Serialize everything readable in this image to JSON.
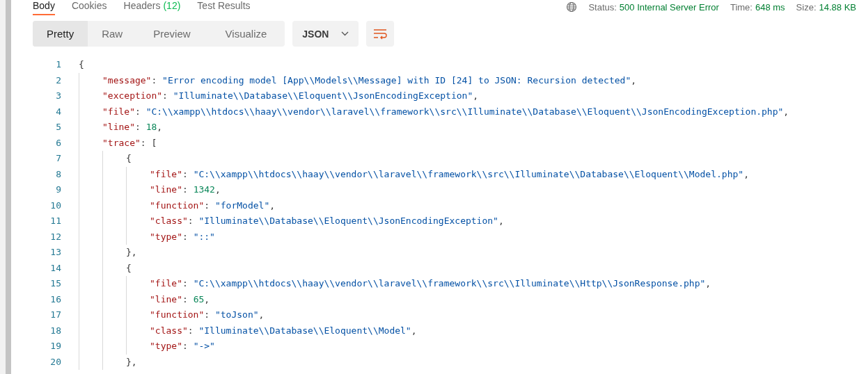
{
  "response_tabs": [
    {
      "label": "Body",
      "selected": true
    },
    {
      "label": "Cookies",
      "selected": false
    },
    {
      "label": "Headers",
      "count": "(12)",
      "selected": false
    },
    {
      "label": "Test Results",
      "selected": false
    }
  ],
  "status_bar": [
    {
      "label": "Status:",
      "value": "500 Internal Server Error"
    },
    {
      "label": "Time:",
      "value": "648 ms"
    },
    {
      "label": "Size:",
      "value": "14.88 KB"
    }
  ],
  "view_modes": [
    {
      "label": "Pretty",
      "selected": true
    },
    {
      "label": "Raw",
      "selected": false
    },
    {
      "label": "Preview",
      "selected": false
    },
    {
      "label": "Visualize",
      "selected": false
    }
  ],
  "format_dropdown": {
    "value": "JSON"
  },
  "wrap_button": {
    "on": false
  },
  "code": [
    {
      "number": "1",
      "tokens": [
        {
          "kind": "punct",
          "text": "{"
        }
      ],
      "children": [
        {
          "number": "2",
          "tokens": [
            {
              "kind": "key",
              "text": "\"message\""
            },
            {
              "kind": "punct",
              "text": ": "
            },
            {
              "kind": "string",
              "text": "\"Error encoding model [App\\\\Models\\\\Message] with ID [24] to JSON: Recursion detected\""
            },
            {
              "kind": "punct",
              "text": ","
            }
          ]
        },
        {
          "number": "3",
          "tokens": [
            {
              "kind": "key",
              "text": "\"exception\""
            },
            {
              "kind": "punct",
              "text": ": "
            },
            {
              "kind": "string",
              "text": "\"Illuminate\\\\Database\\\\Eloquent\\\\JsonEncodingException\""
            },
            {
              "kind": "punct",
              "text": ","
            }
          ]
        },
        {
          "number": "4",
          "tokens": [
            {
              "kind": "key",
              "text": "\"file\""
            },
            {
              "kind": "punct",
              "text": ": "
            },
            {
              "kind": "string",
              "text": "\"C:\\\\xampp\\\\htdocs\\\\haay\\\\vendor\\\\laravel\\\\framework\\\\src\\\\Illuminate\\\\Database\\\\Eloquent\\\\JsonEncodingException.php\""
            },
            {
              "kind": "punct",
              "text": ","
            }
          ]
        },
        {
          "number": "5",
          "tokens": [
            {
              "kind": "key",
              "text": "\"line\""
            },
            {
              "kind": "punct",
              "text": ": "
            },
            {
              "kind": "number",
              "text": "18"
            },
            {
              "kind": "punct",
              "text": ","
            }
          ]
        },
        {
          "number": "6",
          "tokens": [
            {
              "kind": "key",
              "text": "\"trace\""
            },
            {
              "kind": "punct",
              "text": ": ["
            }
          ],
          "children": [
            {
              "number": "7",
              "tokens": [
                {
                  "kind": "punct",
                  "text": "{"
                }
              ],
              "children": [
                {
                  "number": "8",
                  "tokens": [
                    {
                      "kind": "key",
                      "text": "\"file\""
                    },
                    {
                      "kind": "punct",
                      "text": ": "
                    },
                    {
                      "kind": "string",
                      "text": "\"C:\\\\xampp\\\\htdocs\\\\haay\\\\vendor\\\\laravel\\\\framework\\\\src\\\\Illuminate\\\\Database\\\\Eloquent\\\\Model.php\""
                    },
                    {
                      "kind": "punct",
                      "text": ","
                    }
                  ]
                },
                {
                  "number": "9",
                  "tokens": [
                    {
                      "kind": "key",
                      "text": "\"line\""
                    },
                    {
                      "kind": "punct",
                      "text": ": "
                    },
                    {
                      "kind": "number",
                      "text": "1342"
                    },
                    {
                      "kind": "punct",
                      "text": ","
                    }
                  ]
                },
                {
                  "number": "10",
                  "tokens": [
                    {
                      "kind": "key",
                      "text": "\"function\""
                    },
                    {
                      "kind": "punct",
                      "text": ": "
                    },
                    {
                      "kind": "string",
                      "text": "\"forModel\""
                    },
                    {
                      "kind": "punct",
                      "text": ","
                    }
                  ]
                },
                {
                  "number": "11",
                  "tokens": [
                    {
                      "kind": "key",
                      "text": "\"class\""
                    },
                    {
                      "kind": "punct",
                      "text": ": "
                    },
                    {
                      "kind": "string",
                      "text": "\"Illuminate\\\\Database\\\\Eloquent\\\\JsonEncodingException\""
                    },
                    {
                      "kind": "punct",
                      "text": ","
                    }
                  ]
                },
                {
                  "number": "12",
                  "tokens": [
                    {
                      "kind": "key",
                      "text": "\"type\""
                    },
                    {
                      "kind": "punct",
                      "text": ": "
                    },
                    {
                      "kind": "string",
                      "text": "\"::\""
                    }
                  ]
                }
              ]
            },
            {
              "number": "13",
              "tokens": [
                {
                  "kind": "punct",
                  "text": "},"
                }
              ]
            },
            {
              "number": "14",
              "tokens": [
                {
                  "kind": "punct",
                  "text": "{"
                }
              ],
              "children": [
                {
                  "number": "15",
                  "tokens": [
                    {
                      "kind": "key",
                      "text": "\"file\""
                    },
                    {
                      "kind": "punct",
                      "text": ": "
                    },
                    {
                      "kind": "string",
                      "text": "\"C:\\\\xampp\\\\htdocs\\\\haay\\\\vendor\\\\laravel\\\\framework\\\\src\\\\Illuminate\\\\Http\\\\JsonResponse.php\""
                    },
                    {
                      "kind": "punct",
                      "text": ","
                    }
                  ]
                },
                {
                  "number": "16",
                  "tokens": [
                    {
                      "kind": "key",
                      "text": "\"line\""
                    },
                    {
                      "kind": "punct",
                      "text": ": "
                    },
                    {
                      "kind": "number",
                      "text": "65"
                    },
                    {
                      "kind": "punct",
                      "text": ","
                    }
                  ]
                },
                {
                  "number": "17",
                  "tokens": [
                    {
                      "kind": "key",
                      "text": "\"function\""
                    },
                    {
                      "kind": "punct",
                      "text": ": "
                    },
                    {
                      "kind": "string",
                      "text": "\"toJson\""
                    },
                    {
                      "kind": "punct",
                      "text": ","
                    }
                  ]
                },
                {
                  "number": "18",
                  "tokens": [
                    {
                      "kind": "key",
                      "text": "\"class\""
                    },
                    {
                      "kind": "punct",
                      "text": ": "
                    },
                    {
                      "kind": "string",
                      "text": "\"Illuminate\\\\Database\\\\Eloquent\\\\Model\""
                    },
                    {
                      "kind": "punct",
                      "text": ","
                    }
                  ]
                },
                {
                  "number": "19",
                  "tokens": [
                    {
                      "kind": "key",
                      "text": "\"type\""
                    },
                    {
                      "kind": "punct",
                      "text": ": "
                    },
                    {
                      "kind": "string",
                      "text": "\"->\""
                    }
                  ]
                }
              ]
            },
            {
              "number": "20",
              "tokens": [
                {
                  "kind": "punct",
                  "text": "},"
                }
              ]
            }
          ]
        }
      ]
    }
  ]
}
